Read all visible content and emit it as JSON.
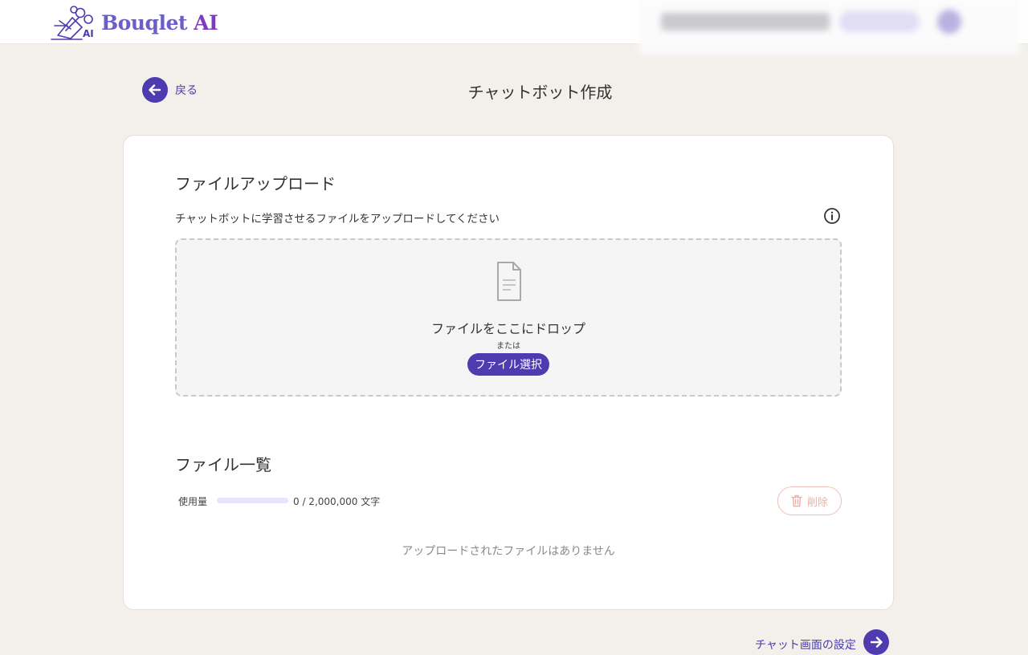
{
  "header": {
    "brand_name": "Bouqlet",
    "brand_suffix": "AI",
    "logo_badge": "AI"
  },
  "nav": {
    "back_label": "戻る",
    "page_title": "チャットボット作成",
    "next_label": "チャット画面の設定"
  },
  "upload": {
    "title": "ファイルアップロード",
    "description": "チャットボットに学習させるファイルをアップロードしてください",
    "drop_text": "ファイルをここにドロップ",
    "or_text": "または",
    "select_button": "ファイル選択"
  },
  "file_list": {
    "title": "ファイル一覧",
    "usage_label": "使用量",
    "usage_value": "0 / 2,000,000 文字",
    "usage_fraction": 0,
    "delete_button": "削除",
    "empty_message": "アップロードされたファイルはありません"
  },
  "colors": {
    "accent": "#4e3bb0",
    "background": "#f3efea",
    "delete": "#f0b0a6"
  }
}
